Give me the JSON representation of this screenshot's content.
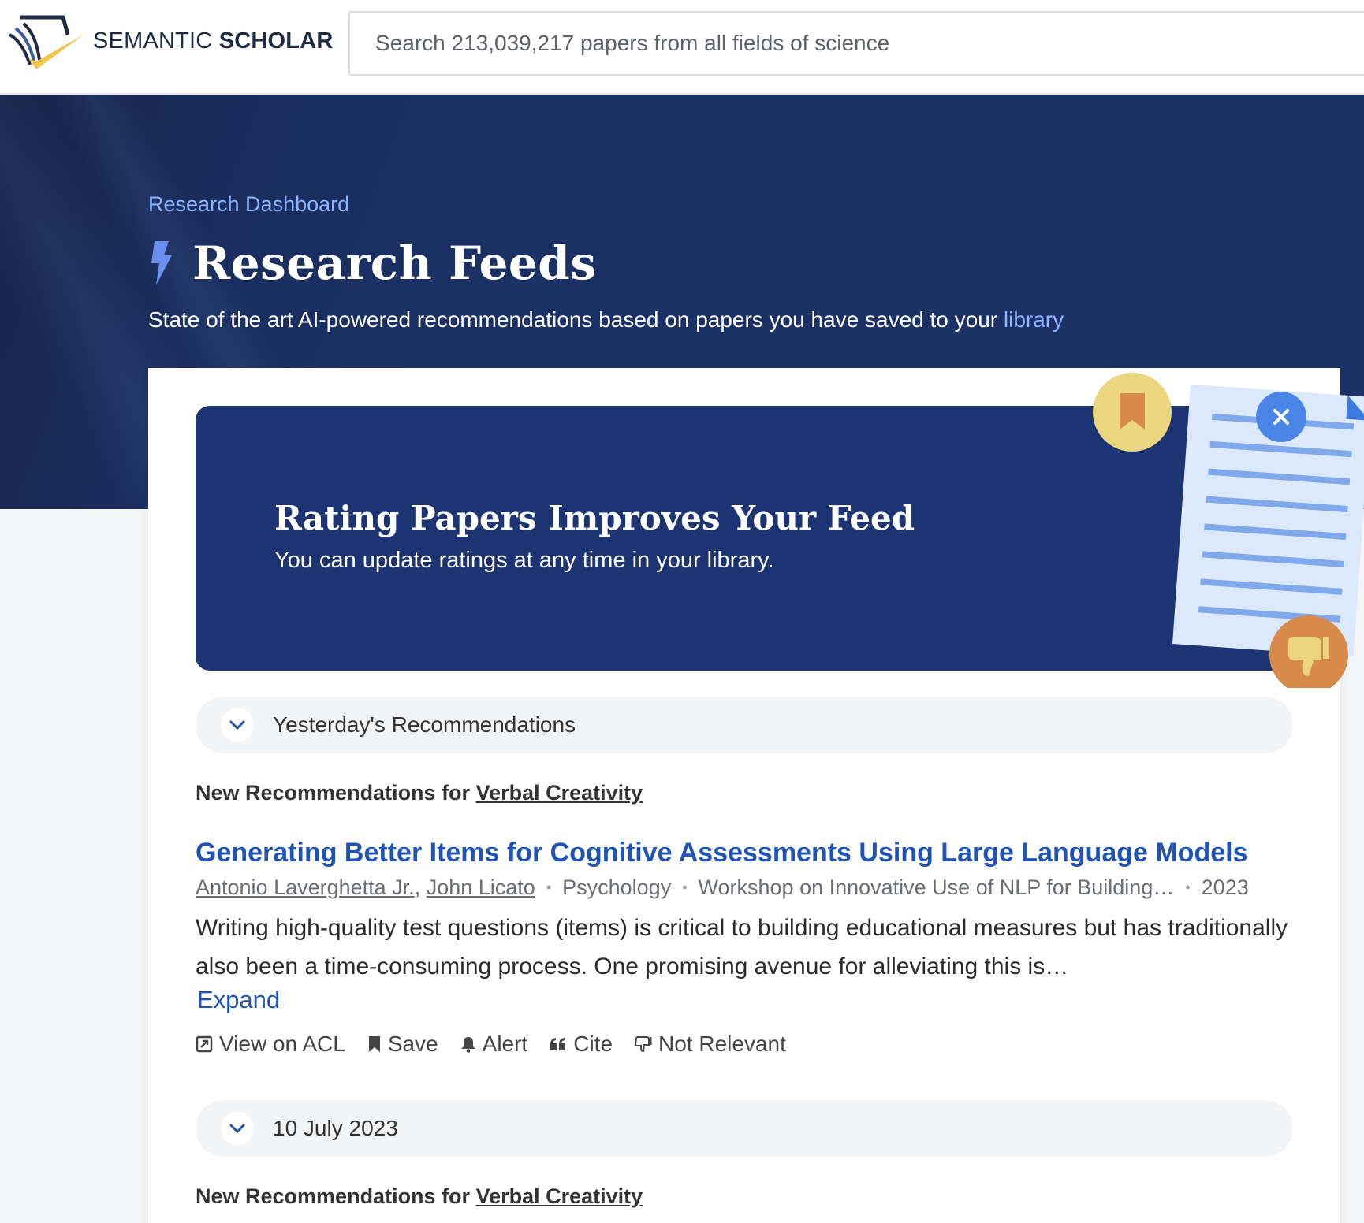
{
  "header": {
    "brand_regular": "SEMANTIC ",
    "brand_bold": "SCHOLAR",
    "search_placeholder": "Search 213,039,217 papers from all fields of science"
  },
  "hero": {
    "breadcrumb": "Research Dashboard",
    "title": "Research Feeds",
    "subtitle": "State of the art AI-powered recommendations based on papers you have saved to your ",
    "subtitle_link": "library"
  },
  "banner": {
    "title": "Rating Papers Improves Your Feed",
    "subtitle": "You can update ratings at any time in your library."
  },
  "feed": [
    {
      "date_label": "Yesterday's Recommendations",
      "rec_prefix": "New Recommendations for ",
      "rec_topic": "Verbal Creativity",
      "paper": {
        "title": "Generating Better Items for Cognitive Assessments Using Large Language Models",
        "authors": [
          "Antonio Laverghetta Jr.",
          "John Licato"
        ],
        "field": "Psychology",
        "venue": "Workshop on Innovative Use of NLP for Building…",
        "year": "2023",
        "abstract": "Writing high-quality test questions (items) is critical to building educational measures but has traditionally also been a time-consuming process. One promising avenue for alleviating this is…",
        "expand_label": "Expand",
        "actions": {
          "view": "View on ACL",
          "save": "Save",
          "alert": "Alert",
          "cite": "Cite",
          "not_relevant": "Not Relevant"
        }
      }
    },
    {
      "date_label": "10 July 2023",
      "rec_prefix": "New Recommendations for ",
      "rec_topic": "Verbal Creativity"
    }
  ],
  "icons": {
    "logo": "semantic-scholar-logo",
    "bolt": "bolt-icon",
    "close": "close-icon",
    "chevron": "chevron-down-icon",
    "bookmark": "bookmark-icon",
    "thumbs_down": "thumbs-down-icon",
    "external": "external-link-icon",
    "bell": "bell-icon",
    "quote": "quote-icon"
  },
  "colors": {
    "hero_bg": "#1c3266",
    "banner_bg": "#1c3471",
    "link_light": "#8fb3ff",
    "link_dark": "#1f53b6",
    "close_btn": "#4a86e8",
    "bookmark_badge": "#ecd57f",
    "thumbs_badge": "#d78a4a"
  }
}
